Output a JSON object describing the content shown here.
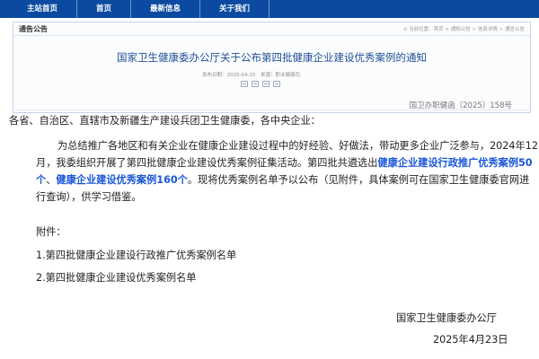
{
  "nav": {
    "items": [
      "主站首页",
      "首页",
      "最新信息",
      "关于我们"
    ]
  },
  "panel": {
    "title": "通告公告",
    "breadcrumb": "⊙ 当前位置：首页 > 通知公告 > 信息详情 > 通告公告"
  },
  "document": {
    "title": "国家卫生健康委办公厅关于公布第四批健康企业建设优秀案例的通知",
    "meta": "发布日期：2025-04-25　来源：职业健康司",
    "number": "国卫办职健函〔2025〕158号",
    "salutation": "各省、自治区、直辖市及新疆生产建设兵团卫生健康委，各中央企业：",
    "body": {
      "part1": "为总结推广各地区和有关企业在健康企业建设过程中的好经验、好做法，带动更多企业广泛参与，2024年12月，我委组织开展了第四批健康企业建设优秀案例征集活动。第四批共遴选出",
      "highlight1": "健康企业建设行政推广优秀案例50个",
      "part2": "、",
      "highlight2": "健康企业建设优秀案例160个",
      "part3": "。现将优秀案例名单予以公布（见附件，具体案例可在国家卫生健康委官网进行查询），供学习借鉴。"
    },
    "attachments_label": "附件：",
    "attachments": [
      "1.第四批健康企业建设行政推广优秀案例名单",
      "2.第四批健康企业建设优秀案例名单"
    ],
    "signature": "国家卫生健康委办公厅",
    "date": "2025年4月23日"
  },
  "colors": {
    "nav_background": "#0b4aa0",
    "title_blue": "#1f4f96",
    "highlight_blue": "#1a56d6"
  },
  "icons": [
    "weibo-share-icon",
    "wechat-share-icon",
    "qzone-share-icon",
    "print-icon"
  ]
}
